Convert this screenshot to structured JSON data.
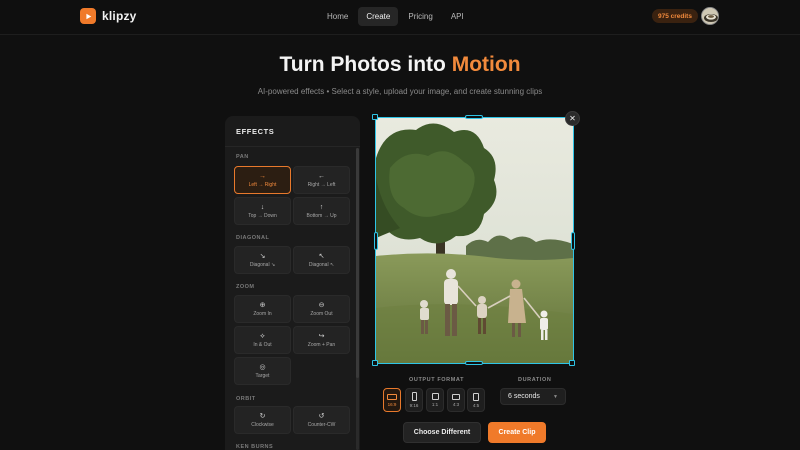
{
  "app": {
    "name": "klipzy"
  },
  "nav": {
    "items": [
      "Home",
      "Create",
      "Pricing",
      "API"
    ],
    "active": "Create"
  },
  "credits": "975 credits",
  "hero": {
    "title_main": "Turn Photos into ",
    "title_accent": "Motion",
    "subtitle": "AI-powered effects • Select a style, upload your image, and create stunning clips"
  },
  "effects": {
    "title": "EFFECTS",
    "sections": {
      "pan": {
        "label": "PAN",
        "items": [
          {
            "label": "Left → Right",
            "icon": "arrow-right-icon",
            "glyph": "→"
          },
          {
            "label": "Right → Left",
            "icon": "arrow-left-icon",
            "glyph": "←"
          },
          {
            "label": "Top → Down",
            "icon": "arrow-down-icon",
            "glyph": "↓"
          },
          {
            "label": "Bottom → Up",
            "icon": "arrow-up-icon",
            "glyph": "↑"
          }
        ]
      },
      "diagonal": {
        "label": "DIAGONAL",
        "items": [
          {
            "label": "Diagonal ↘",
            "icon": "arrow-down-right-icon",
            "glyph": "↘"
          },
          {
            "label": "Diagonal ↖",
            "icon": "arrow-up-left-icon",
            "glyph": "↖"
          }
        ]
      },
      "zoom": {
        "label": "ZOOM",
        "items": [
          {
            "label": "Zoom In",
            "icon": "zoom-in-icon",
            "glyph": "⊕"
          },
          {
            "label": "Zoom Out",
            "icon": "zoom-out-icon",
            "glyph": "⊖"
          },
          {
            "label": "In & Out",
            "icon": "in-out-icon",
            "glyph": "⟡"
          },
          {
            "label": "Zoom + Pan",
            "icon": "zoom-pan-icon",
            "glyph": "↪"
          },
          {
            "label": "Target",
            "icon": "target-icon",
            "glyph": "◎"
          }
        ]
      },
      "orbit": {
        "label": "ORBIT",
        "items": [
          {
            "label": "Clockwise",
            "icon": "rotate-cw-icon",
            "glyph": "↻"
          },
          {
            "label": "Counter-CW",
            "icon": "rotate-ccw-icon",
            "glyph": "↺"
          }
        ]
      },
      "next": {
        "label": "KEN BURNS"
      }
    },
    "selected": "Left → Right"
  },
  "output": {
    "format_label": "OUTPUT FORMAT",
    "formats": [
      "16:9",
      "9:16",
      "1:1",
      "4:3",
      "4:5"
    ],
    "selected_format": "16:9",
    "duration_label": "DURATION",
    "duration_value": "6 seconds"
  },
  "actions": {
    "choose": "Choose Different",
    "create": "Create Clip"
  },
  "colors": {
    "accent": "#f07a2a",
    "selection": "#2ec4e6",
    "background": "#101010"
  }
}
